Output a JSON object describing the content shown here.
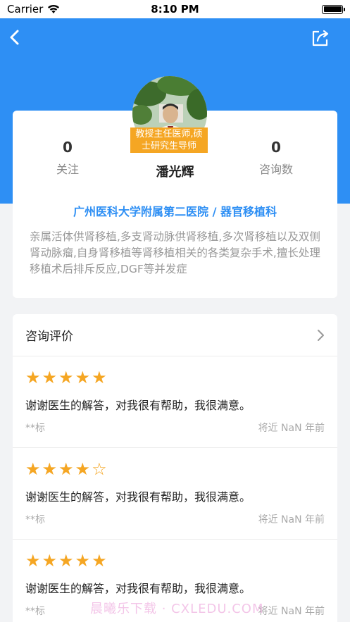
{
  "status_bar": {
    "carrier": "Carrier",
    "time": "8:10 PM"
  },
  "header": {
    "back_icon": "chevron-left-icon",
    "share_icon": "share-icon",
    "accent_color": "#2e8ff4"
  },
  "doctor": {
    "title_tag": "教授主任医师,硕士研究生导师",
    "name": "潘光辉",
    "follow_count": "0",
    "follow_label": "关注",
    "consult_count": "0",
    "consult_label": "咨询数",
    "hospital": "广州医科大学附属第二医院 / 器官移植科",
    "specialty": "亲属活体供肾移植,多支肾动脉供肾移植,多次肾移植以及双侧肾动脉瘤,自身肾移植等肾移植相关的各类复杂手术,擅长处理移植术后排斥反应,DGF等并发症"
  },
  "reviews": {
    "title": "咨询评价",
    "items": [
      {
        "stars": "★★★★★",
        "rating": 5,
        "text": "谢谢医生的解答，对我很有帮助，我很满意。",
        "user": "**标",
        "time": "将近 NaN 年前"
      },
      {
        "stars": "★★★★☆",
        "rating": 4,
        "text": "谢谢医生的解答，对我很有帮助，我很满意。",
        "user": "**标",
        "time": "将近 NaN 年前"
      },
      {
        "stars": "★★★★★",
        "rating": 5,
        "text": "谢谢医生的解答，对我很有帮助，我很满意。",
        "user": "**标",
        "time": "将近 NaN 年前"
      }
    ]
  },
  "watermark": "晨曦乐下载 · CXLEDU.COM"
}
